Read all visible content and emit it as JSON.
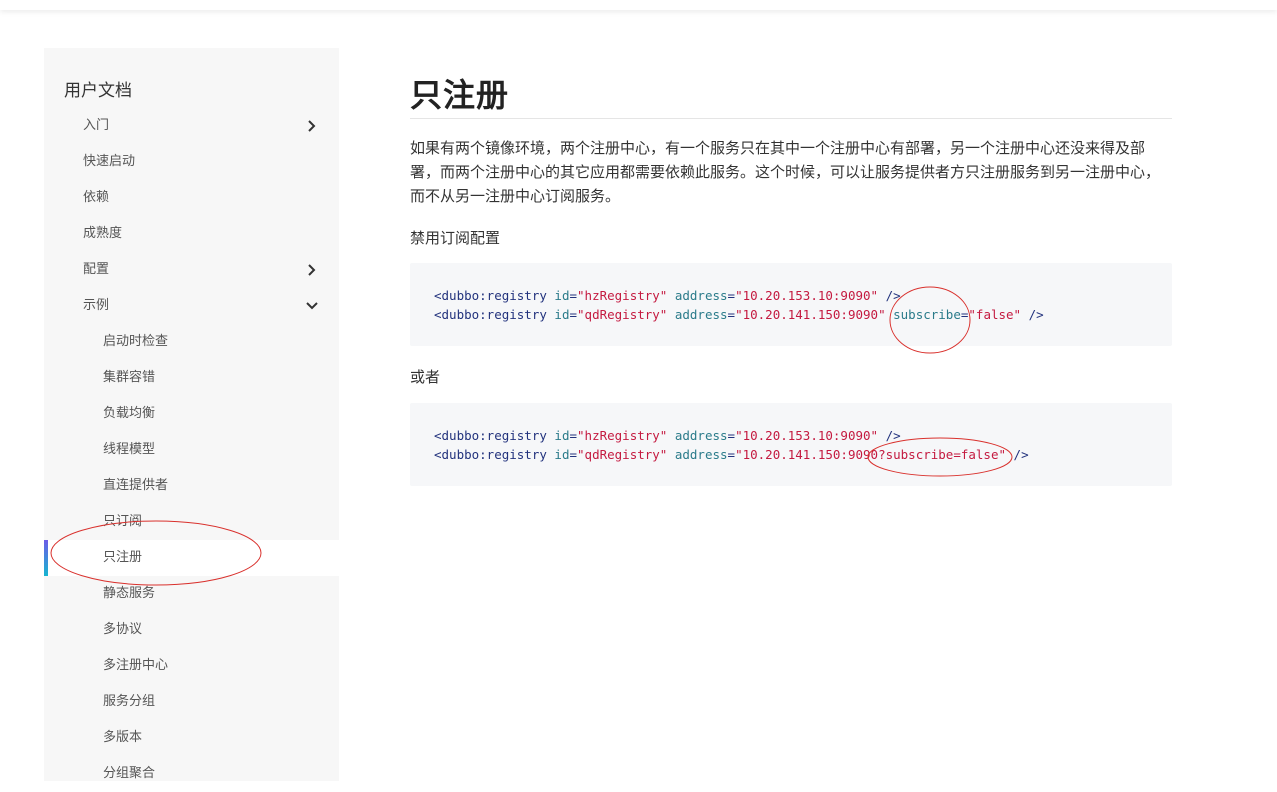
{
  "sidebar": {
    "title": "用户文档",
    "items": [
      {
        "label": "入门"
      },
      {
        "label": "快速启动"
      },
      {
        "label": "依赖"
      },
      {
        "label": "成熟度"
      },
      {
        "label": "配置"
      },
      {
        "label": "示例"
      },
      {
        "label": "启动时检查"
      },
      {
        "label": "集群容错"
      },
      {
        "label": "负载均衡"
      },
      {
        "label": "线程模型"
      },
      {
        "label": "直连提供者"
      },
      {
        "label": "只订阅"
      },
      {
        "label": "只注册"
      },
      {
        "label": "静态服务"
      },
      {
        "label": "多协议"
      },
      {
        "label": "多注册中心"
      },
      {
        "label": "服务分组"
      },
      {
        "label": "多版本"
      },
      {
        "label": "分组聚合"
      }
    ]
  },
  "article": {
    "title": "只注册",
    "paragraph": "如果有两个镜像环境，两个注册中心，有一个服务只在其中一个注册中心有部署，另一个注册中心还没来得及部署，而两个注册中心的其它应用都需要依赖此服务。这个时候，可以让服务提供者方只注册服务到另一注册中心，而不从另一注册中心订阅服务。",
    "label1": "禁用订阅配置",
    "label2": "或者"
  },
  "code1": {
    "line1": {
      "tag": "<dubbo:registry",
      "id_attr": "id",
      "eq1": "=",
      "id_val": "\"hzRegistry\"",
      "addr_attr": "address",
      "eq2": "=",
      "addr_val": "\"10.20.153.10:9090\"",
      "close": "/>"
    },
    "line2": {
      "tag": "<dubbo:registry",
      "id_attr": "id",
      "eq1": "=",
      "id_val": "\"qdRegistry\"",
      "addr_attr": "address",
      "eq2": "=",
      "addr_val": "\"10.20.141.150:9090\"",
      "sub_attr": "subscribe",
      "eq3": "=",
      "sub_val": "\"false\"",
      "close": "/>"
    }
  },
  "code2": {
    "line1": {
      "tag": "<dubbo:registry",
      "id_attr": "id",
      "eq1": "=",
      "id_val": "\"hzRegistry\"",
      "addr_attr": "address",
      "eq2": "=",
      "addr_val": "\"10.20.153.10:9090\"",
      "close": "/>"
    },
    "line2": {
      "tag": "<dubbo:registry",
      "id_attr": "id",
      "eq1": "=",
      "id_val": "\"qdRegistry\"",
      "addr_attr": "address",
      "eq2": "=",
      "addr_val": "\"10.20.141.150:9090?subscribe=false\"",
      "close": "/>"
    }
  },
  "colors": {
    "annotation": "#d9302c",
    "active_bar_top": "#6c5ce7",
    "active_bar_bottom": "#16b5d0"
  }
}
